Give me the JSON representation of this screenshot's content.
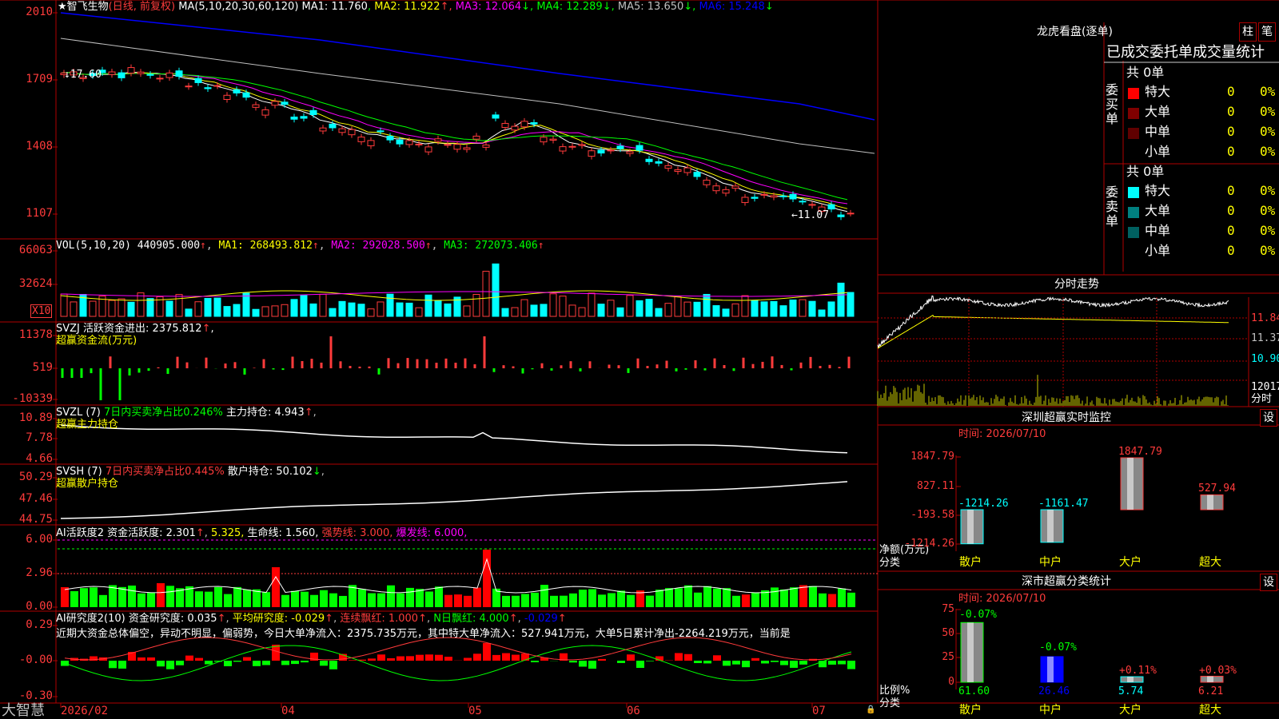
{
  "stock": {
    "name": "智飞生物",
    "mode": "(日线, 前复权)",
    "ma_label": "MA(5,10,20,30,60,120)",
    "ma": [
      {
        "label": "MA1: 11.760",
        "arrow": "",
        "color": "#ffffff"
      },
      {
        "label": "MA2: 11.922",
        "arrow": "↑",
        "color": "#ffff00"
      },
      {
        "label": "MA3: 12.064",
        "arrow": "↓",
        "color": "#ff00ff"
      },
      {
        "label": "MA4: 12.289",
        "arrow": "↓",
        "color": "#00ff00"
      },
      {
        "label": "MA5: 13.650",
        "arrow": "↓",
        "color": "#c0c0c0"
      },
      {
        "label": "MA6: 15.248",
        "arrow": "↓",
        "color": "#0000ff"
      }
    ],
    "y_ticks": [
      "2010",
      "1709",
      "1408",
      "1107"
    ],
    "high_mark": "17.60",
    "low_mark": "←11.07"
  },
  "vol": {
    "label": "VOL(5,10,20)",
    "value": "440905.000",
    "ma1": "MA1: 268493.812",
    "ma2": "MA2: 292028.500",
    "ma3": "MA3: 272073.406",
    "y_ticks": [
      "66063",
      "32624"
    ],
    "unit": "X10"
  },
  "svzj": {
    "label": "SVZJ  活跃资金进出: 2375.812",
    "sub": "超赢资金流(万元)",
    "y_ticks": [
      "11378",
      "519",
      "-10339"
    ]
  },
  "svzl": {
    "label": "SVZL (7)",
    "period": "7日内买卖净占比0.246%",
    "hold": "主力持仓: 4.943",
    "sub": "超赢主力持仓",
    "y_ticks": [
      "10.89",
      "7.78",
      "4.66"
    ]
  },
  "svsh": {
    "label": "SVSH (7)",
    "period": "7日内买卖净占比0.445%",
    "hold": "散户持仓: 50.102",
    "sub": "超赢散户持仓",
    "y_ticks": [
      "50.29",
      "47.46",
      "44.75"
    ]
  },
  "ai_active": {
    "label": "AI活跃度2",
    "fund": "资金活跃度: 2.301",
    "v2": "5.325,",
    "life": "生命线: 1.560,",
    "strong": "强势线: 3.000,",
    "burst": "爆发线: 6.000,",
    "y_ticks": [
      "6.00",
      "2.96",
      "0.00"
    ]
  },
  "ai_research": {
    "label": "AI研究度2(10)",
    "research": "资金研究度: 0.035",
    "avg": "平均研究度: -0.029",
    "red": "连续飘红: 1.000",
    "nred": "N日飘红: 4.000",
    "last": "-0.029",
    "desc": "近期大资金总体偏空，异动不明显，偏弱势，今日大单净流入：2375.735万元，其中特大单净流入：527.941万元，大单5日累计净出-2264.219万元，当前是",
    "y_ticks": [
      "0.29",
      "-0.00",
      "-0.30"
    ]
  },
  "x_axis": [
    "2026/02",
    "04",
    "05",
    "06",
    "07"
  ],
  "brand": "大智慧",
  "right": {
    "title": "龙虎看盘(逐单)",
    "btn1": "柱",
    "btn2": "笔",
    "tab_header": "已成交委托单成交量统计",
    "buy": {
      "side": "委买单",
      "total": "共 0单",
      "rows": [
        {
          "name": "特大",
          "v": "0",
          "p": "0%",
          "c": "#ff0000"
        },
        {
          "name": "大单",
          "v": "0",
          "p": "0%",
          "c": "#800000"
        },
        {
          "name": "中单",
          "v": "0",
          "p": "0%",
          "c": "#600000"
        },
        {
          "name": "小单",
          "v": "0",
          "p": "0%",
          "c": "#000000"
        }
      ]
    },
    "sell": {
      "side": "委卖单",
      "total": "共 0单",
      "rows": [
        {
          "name": "特大",
          "v": "0",
          "p": "0%",
          "c": "#00ffff"
        },
        {
          "name": "大单",
          "v": "0",
          "p": "0%",
          "c": "#008080"
        },
        {
          "name": "中单",
          "v": "0",
          "p": "0%",
          "c": "#006060"
        },
        {
          "name": "小单",
          "v": "0",
          "p": "0%",
          "c": "#000000"
        }
      ]
    },
    "intraday": {
      "title": "分时走势",
      "prices": [
        "11.84",
        "11.37",
        "10.90"
      ],
      "vol": "12017",
      "vol_unit": "分时"
    },
    "sz_monitor": {
      "title": "深圳超赢实时监控",
      "btn": "设",
      "time": "时间: 2026/07/10",
      "y_ticks": [
        "1847.79",
        "827.11",
        "-193.58",
        "-1214.26"
      ],
      "ylabel": "净额(万元)",
      "xlabel": "分类",
      "categories": [
        "散户",
        "中户",
        "大户",
        "超大"
      ],
      "values": [
        -1214.26,
        -1161.47,
        1847.79,
        527.94
      ],
      "labels": [
        "-1214.26",
        "-1161.47",
        "1847.79",
        "527.94"
      ]
    },
    "sz_stats": {
      "title": "深市超赢分类统计",
      "btn": "设",
      "time": "时间: 2026/07/10",
      "y_ticks": [
        "75",
        "50",
        "25",
        "0"
      ],
      "ylabel": "比例%",
      "xlabel": "分类",
      "categories": [
        "散户",
        "中户",
        "大户",
        "超大"
      ],
      "values": [
        61.6,
        26.46,
        5.74,
        6.21
      ],
      "labels": [
        "61.60",
        "26.46",
        "5.74",
        "6.21"
      ],
      "changes": [
        "-0.07%",
        "-0.07%",
        "+0.11%",
        "+0.03%"
      ]
    }
  }
}
